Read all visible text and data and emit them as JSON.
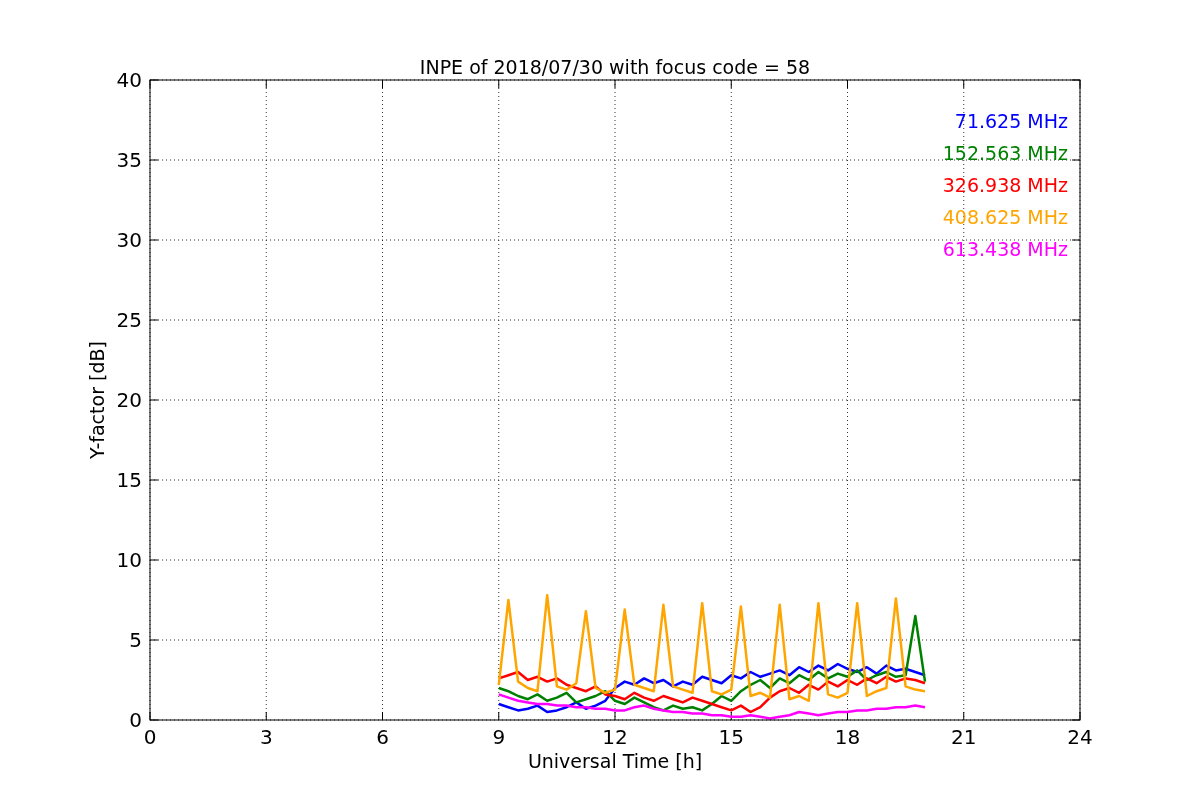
{
  "chart_data": {
    "type": "line",
    "title": "INPE of 2018/07/30 with focus code = 58",
    "xlabel": "Universal Time [h]",
    "ylabel": "Y-factor [dB]",
    "x": [
      9,
      9.25,
      9.5,
      9.75,
      10,
      10.25,
      10.5,
      10.75,
      11,
      11.25,
      11.5,
      11.75,
      12,
      12.25,
      12.5,
      12.75,
      13,
      13.25,
      13.5,
      13.75,
      14,
      14.25,
      14.5,
      14.75,
      15,
      15.25,
      15.5,
      15.75,
      16,
      16.25,
      16.5,
      16.75,
      17,
      17.25,
      17.5,
      17.75,
      18,
      18.25,
      18.5,
      18.75,
      19,
      19.25,
      19.5,
      19.75,
      20
    ],
    "series": [
      {
        "name": "71.625 MHz",
        "color": "#0000ff",
        "values": [
          1.0,
          0.8,
          0.6,
          0.7,
          0.9,
          0.5,
          0.6,
          0.8,
          1.1,
          0.7,
          0.9,
          1.2,
          2.0,
          2.4,
          2.2,
          2.6,
          2.3,
          2.5,
          2.1,
          2.4,
          2.2,
          2.7,
          2.5,
          2.3,
          2.8,
          2.6,
          3.0,
          2.7,
          2.9,
          3.1,
          2.8,
          3.3,
          3.0,
          3.4,
          3.1,
          3.5,
          3.2,
          3.0,
          3.3,
          2.9,
          3.4,
          3.1,
          3.2,
          3.0,
          2.8
        ]
      },
      {
        "name": "152.563 MHz",
        "color": "#008000",
        "values": [
          2.0,
          1.8,
          1.5,
          1.3,
          1.6,
          1.2,
          1.4,
          1.7,
          1.1,
          1.3,
          1.5,
          1.8,
          1.2,
          1.0,
          1.4,
          1.1,
          0.8,
          0.6,
          0.9,
          0.7,
          0.8,
          0.6,
          1.0,
          1.5,
          1.2,
          1.8,
          2.2,
          2.5,
          2.0,
          2.6,
          2.3,
          2.8,
          2.5,
          3.0,
          2.6,
          2.9,
          2.7,
          3.1,
          2.5,
          2.8,
          3.0,
          2.7,
          2.8,
          6.5,
          2.4
        ]
      },
      {
        "name": "326.938 MHz",
        "color": "#ff0000",
        "values": [
          2.6,
          2.8,
          3.0,
          2.5,
          2.7,
          2.4,
          2.6,
          2.2,
          2.0,
          1.8,
          2.1,
          1.6,
          1.5,
          1.3,
          1.7,
          1.4,
          1.2,
          1.5,
          1.3,
          1.1,
          1.4,
          1.2,
          1.0,
          0.8,
          0.6,
          0.9,
          0.5,
          0.8,
          1.4,
          1.8,
          2.0,
          1.7,
          2.2,
          1.9,
          2.4,
          2.1,
          2.5,
          2.2,
          2.6,
          2.3,
          2.7,
          2.4,
          2.6,
          2.5,
          2.3
        ]
      },
      {
        "name": "408.625 MHz",
        "color": "#ffa500",
        "values": [
          2.2,
          7.5,
          2.4,
          2.0,
          1.8,
          7.8,
          2.1,
          1.9,
          2.3,
          6.8,
          2.0,
          1.7,
          1.9,
          6.9,
          2.2,
          2.0,
          1.8,
          7.2,
          2.1,
          1.9,
          1.7,
          7.3,
          1.8,
          1.6,
          1.9,
          7.1,
          1.5,
          1.7,
          1.4,
          7.2,
          1.3,
          1.5,
          1.2,
          7.3,
          1.6,
          1.4,
          1.7,
          7.3,
          1.5,
          1.8,
          2.0,
          7.6,
          2.1,
          1.9,
          1.8
        ]
      },
      {
        "name": "613.438 MHz",
        "color": "#ff00ff",
        "values": [
          1.6,
          1.4,
          1.2,
          1.1,
          1.0,
          1.0,
          0.9,
          0.9,
          0.8,
          0.8,
          0.7,
          0.7,
          0.6,
          0.6,
          0.8,
          0.9,
          0.7,
          0.6,
          0.5,
          0.5,
          0.4,
          0.4,
          0.3,
          0.3,
          0.2,
          0.2,
          0.3,
          0.2,
          0.1,
          0.2,
          0.3,
          0.5,
          0.4,
          0.3,
          0.4,
          0.5,
          0.5,
          0.6,
          0.6,
          0.7,
          0.7,
          0.8,
          0.8,
          0.9,
          0.8
        ]
      }
    ],
    "xlim": [
      0,
      24
    ],
    "ylim": [
      0,
      40
    ],
    "xticks": [
      0,
      3,
      6,
      9,
      12,
      15,
      18,
      21,
      24
    ],
    "yticks": [
      0,
      5,
      10,
      15,
      20,
      25,
      30,
      35,
      40
    ],
    "grid": true
  }
}
